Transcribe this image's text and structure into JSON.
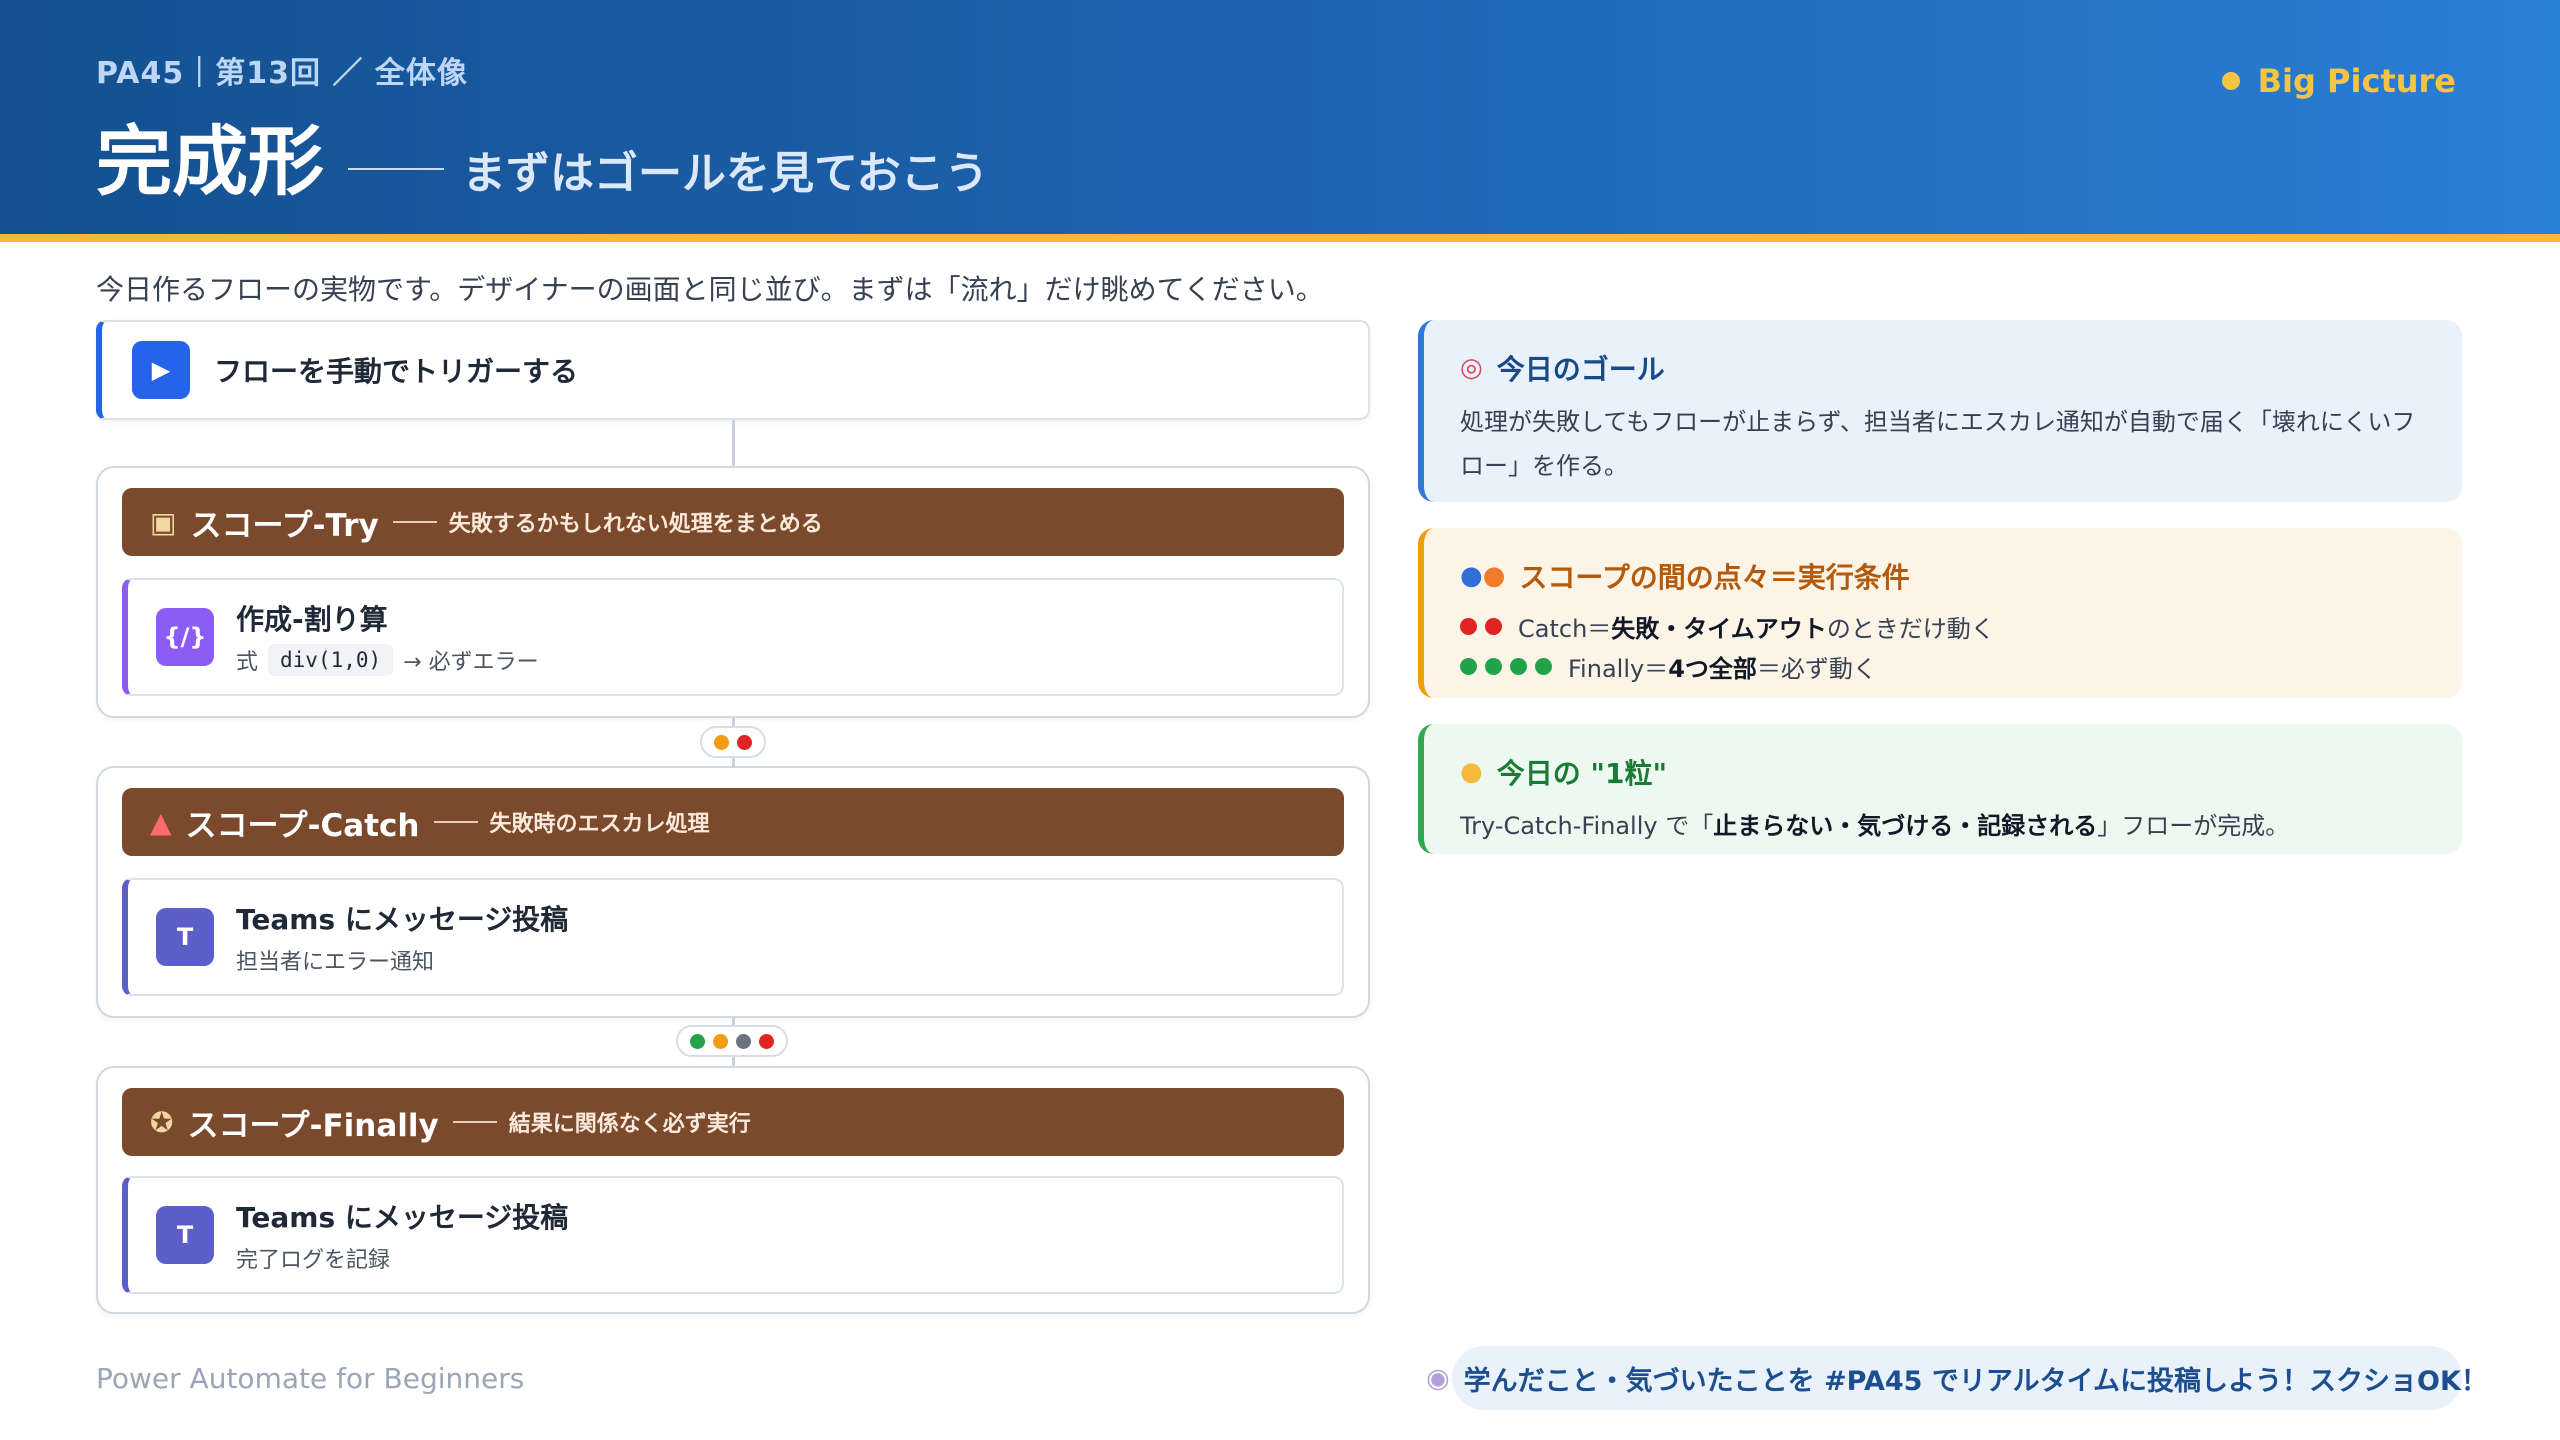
{
  "header": {
    "breadcrumb": "PA45｜第13回 ／ 全体像",
    "title": "完成形",
    "subtitle": "まずはゴールを見ておこう",
    "badge": "Big Picture"
  },
  "intro": "今日作るフローの実物です。デザイナーの画面と同じ並び。まずは「流れ」だけ眺めてください。",
  "flow": {
    "trigger": {
      "label": "フローを手動でトリガーする",
      "icon": "play-icon"
    },
    "scopes": [
      {
        "name": "スコープ-Try",
        "desc": "失敗するかもしれない処理をまとめる",
        "icon": "package-icon",
        "action": {
          "title": "作成-割り算",
          "sub_prefix": "式",
          "sub_code": "div(1,0)",
          "sub_suffix": "→ 必ずエラー",
          "icon_text": "{/}"
        }
      },
      {
        "name": "スコープ-Catch",
        "desc": "失敗時のエスカレ処理",
        "icon": "siren-icon",
        "action": {
          "title": "Teams にメッセージ投稿",
          "sub": "担当者にエラー通知",
          "icon_text": "T"
        }
      },
      {
        "name": "スコープ-Finally",
        "desc": "結果に関係なく必ず実行",
        "icon": "broom-icon",
        "action": {
          "title": "Teams にメッセージ投稿",
          "sub": "完了ログを記録",
          "icon_text": "T"
        }
      }
    ],
    "run_after_colors": {
      "catch": [
        "#f39c12",
        "#e02424"
      ],
      "finally": [
        "#22a34a",
        "#f39c12",
        "#6b7280",
        "#e02424"
      ]
    }
  },
  "cards": {
    "goal": {
      "title": "今日のゴール",
      "body": "処理が失敗してもフローが止まらず、担当者にエスカレ通知が自動で届く「壊れにくいフロー」を作る。"
    },
    "conditions": {
      "title": "スコープの間の点々＝実行条件",
      "catch_prefix": "Catch＝",
      "catch_bold": "失敗・タイムアウト",
      "catch_suffix": "のときだけ動く",
      "catch_dots": [
        "#e02424",
        "#e02424"
      ],
      "finally_prefix": "Finally＝",
      "finally_bold": "4つ全部",
      "finally_suffix": "＝必ず動く",
      "finally_dots": [
        "#22a34a",
        "#22a34a",
        "#22a34a",
        "#22a34a"
      ]
    },
    "grain": {
      "title": "今日の \"1粒\"",
      "prefix": "Try-Catch-Finally で「",
      "bold": "止まらない・気づける・記録される",
      "suffix": "」フローが完成。"
    }
  },
  "footer": {
    "left": "Power Automate for Beginners",
    "pill": "学んだこと・気づいたことを #PA45 でリアルタイムに投稿しよう！スクショOK！"
  },
  "colors": {
    "header_start": "#14508f",
    "header_end": "#2a7fd6",
    "accent_yellow": "#f6b93b",
    "scope_brown": "#7b4a2c",
    "trigger_blue": "#2563eb",
    "code_purple": "#8b5cf6",
    "teams_purple": "#5b5fc7"
  }
}
